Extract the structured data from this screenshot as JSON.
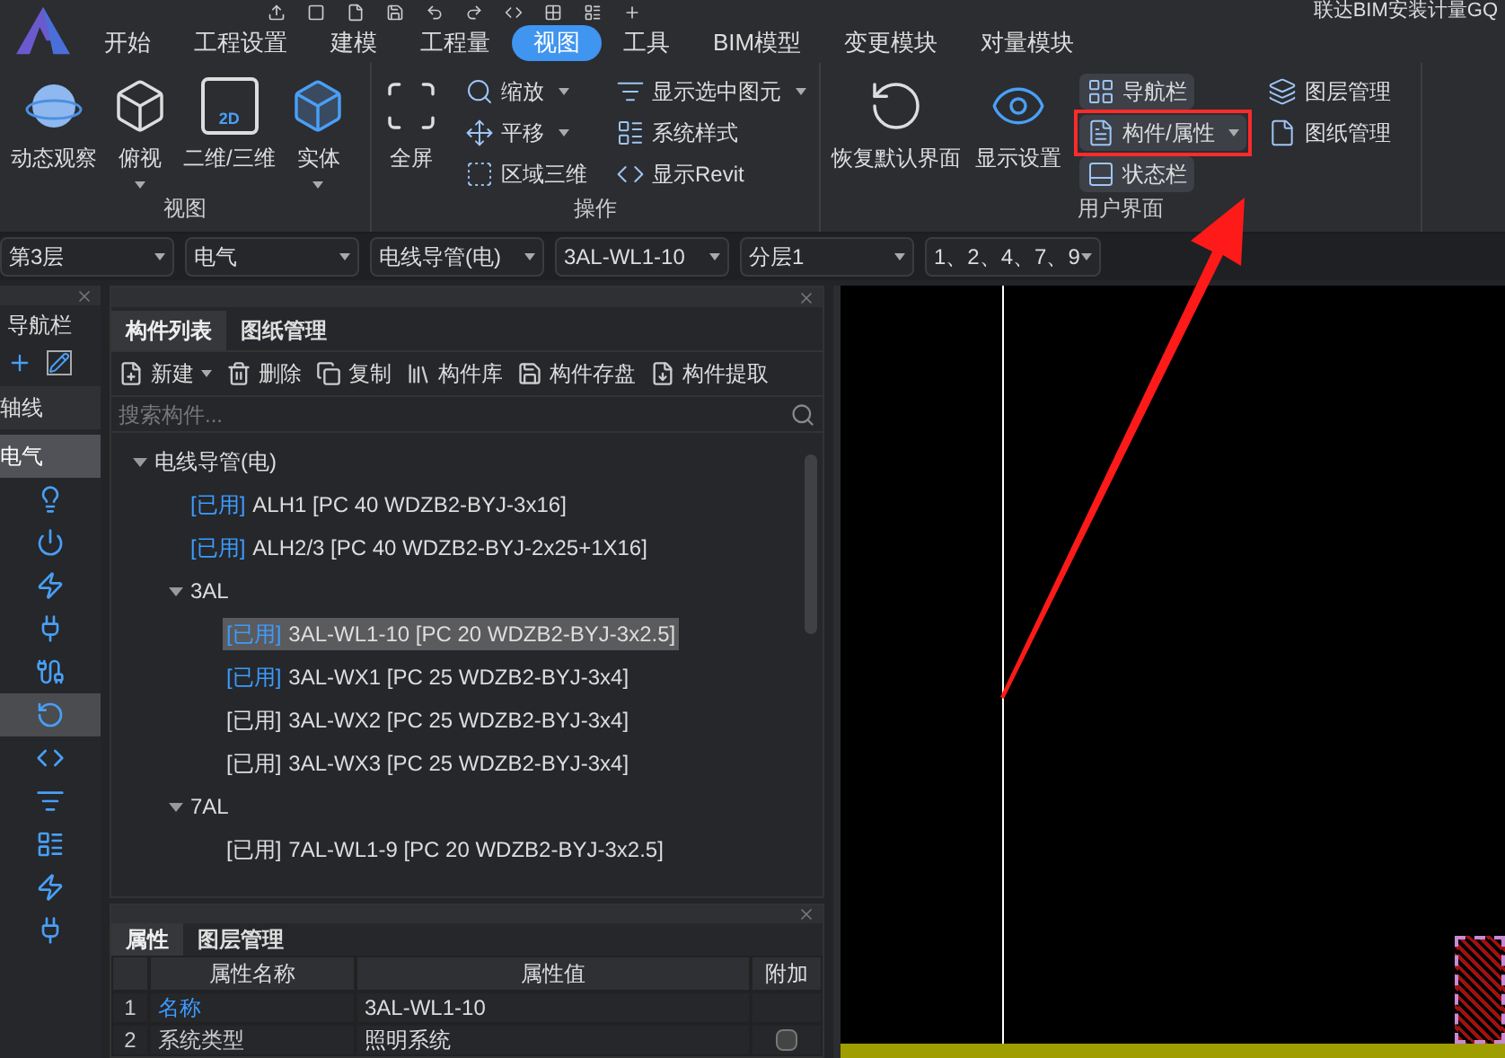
{
  "window": {
    "title": "联达BIM安装计量GQ"
  },
  "menu": [
    {
      "label": "开始",
      "selected": false
    },
    {
      "label": "工程设置",
      "selected": false
    },
    {
      "label": "建模",
      "selected": false
    },
    {
      "label": "工程量",
      "selected": false
    },
    {
      "label": "视图",
      "selected": true
    },
    {
      "label": "工具",
      "selected": false
    },
    {
      "label": "BIM模型",
      "selected": false
    },
    {
      "label": "变更模块",
      "selected": false
    },
    {
      "label": "对量模块",
      "selected": false
    }
  ],
  "ribbon": {
    "groups": [
      {
        "label": "视图",
        "large": [
          {
            "label": "动态观察",
            "dropdown": false
          },
          {
            "label": "俯视",
            "dropdown": true
          },
          {
            "label": "二维/三维",
            "dropdown": false,
            "icon_text": "2D"
          },
          {
            "label": "实体",
            "dropdown": true
          }
        ]
      },
      {
        "label": "操作",
        "large": [
          {
            "label": "全屏",
            "dropdown": false
          }
        ],
        "columns": [
          [
            {
              "label": "缩放",
              "dropdown": true
            },
            {
              "label": "平移",
              "dropdown": true
            },
            {
              "label": "区域三维",
              "dropdown": false
            }
          ],
          [
            {
              "label": "显示选中图元",
              "dropdown": true
            },
            {
              "label": "系统样式",
              "dropdown": false
            },
            {
              "label": "显示Revit",
              "dropdown": false
            }
          ]
        ]
      },
      {
        "label": "用户界面",
        "large": [
          {
            "label": "恢复默认界面",
            "dropdown": false
          },
          {
            "label": "显示设置",
            "dropdown": false
          }
        ],
        "columns": [
          [
            {
              "label": "导航栏",
              "dropdown": false,
              "on": true,
              "marked": false
            },
            {
              "label": "构件/属性",
              "dropdown": true,
              "on": true,
              "marked": true
            },
            {
              "label": "状态栏",
              "dropdown": false,
              "on": true,
              "marked": false
            }
          ],
          [
            {
              "label": "图层管理",
              "dropdown": false,
              "on": false,
              "marked": false
            },
            {
              "label": "图纸管理",
              "dropdown": false,
              "on": false,
              "marked": false
            }
          ]
        ]
      }
    ]
  },
  "selectors": [
    "第3层",
    "电气",
    "电线导管(电)",
    "3AL-WL1-10",
    "分层1",
    "1、2、4、7、9"
  ],
  "navigation": {
    "title": "导航栏",
    "categories": [
      {
        "label": "轴线",
        "selected": false
      },
      {
        "label": "电气",
        "selected": true
      }
    ],
    "tools": [
      {
        "selected": false
      },
      {
        "selected": false
      },
      {
        "selected": false
      },
      {
        "selected": false
      },
      {
        "selected": false
      },
      {
        "selected": true
      },
      {
        "selected": false
      },
      {
        "selected": false
      },
      {
        "selected": false
      },
      {
        "selected": false
      },
      {
        "selected": false
      }
    ]
  },
  "component_panel": {
    "tabs": [
      {
        "label": "构件列表",
        "selected": true
      },
      {
        "label": "图纸管理",
        "selected": false
      }
    ],
    "toolbar": [
      {
        "label": "新建",
        "dropdown": true
      },
      {
        "label": "删除",
        "dropdown": false
      },
      {
        "label": "复制",
        "dropdown": false
      },
      {
        "label": "构件库",
        "dropdown": false
      },
      {
        "label": "构件存盘",
        "dropdown": false
      },
      {
        "label": "构件提取",
        "dropdown": false
      }
    ],
    "search": {
      "placeholder": "搜索构件..."
    },
    "tree": [
      {
        "kind": "group",
        "label": "电线导管(电)",
        "expanded": true,
        "children": [
          {
            "kind": "item",
            "tag": "[已用]",
            "tag_highlighted": true,
            "label": "ALH1 [PC 40 WDZB2-BYJ-3x16]",
            "selected": false
          },
          {
            "kind": "item",
            "tag": "[已用]",
            "tag_highlighted": true,
            "label": "ALH2/3 [PC 40 WDZB2-BYJ-2x25+1X16]",
            "selected": false
          },
          {
            "kind": "group",
            "label": "3AL",
            "expanded": true,
            "children": [
              {
                "kind": "item",
                "tag": "[已用]",
                "tag_highlighted": true,
                "label": "3AL-WL1-10 [PC 20 WDZB2-BYJ-3x2.5]",
                "selected": true
              },
              {
                "kind": "item",
                "tag": "[已用]",
                "tag_highlighted": true,
                "label": "3AL-WX1 [PC 25 WDZB2-BYJ-3x4]",
                "selected": false
              },
              {
                "kind": "item",
                "tag": "[已用]",
                "tag_highlighted": false,
                "label": "3AL-WX2 [PC 25 WDZB2-BYJ-3x4]",
                "selected": false
              },
              {
                "kind": "item",
                "tag": "[已用]",
                "tag_highlighted": false,
                "label": "3AL-WX3 [PC 25 WDZB2-BYJ-3x4]",
                "selected": false
              }
            ]
          },
          {
            "kind": "group",
            "label": "7AL",
            "expanded": true,
            "children": [
              {
                "kind": "item",
                "tag": "[已用]",
                "tag_highlighted": false,
                "label": "7AL-WL1-9 [PC 20 WDZB2-BYJ-3x2.5]",
                "selected": false
              }
            ]
          }
        ]
      }
    ]
  },
  "property_panel": {
    "tabs": [
      {
        "label": "属性",
        "selected": true
      },
      {
        "label": "图层管理",
        "selected": false
      }
    ],
    "columns": [
      "属性名称",
      "属性值",
      "附加"
    ],
    "rows": [
      {
        "index": "1",
        "name": "名称",
        "value": "3AL-WL1-10",
        "highlighted": true
      },
      {
        "index": "2",
        "name": "系统类型",
        "value": "照明系统",
        "highlighted": false,
        "checked": false
      }
    ]
  }
}
